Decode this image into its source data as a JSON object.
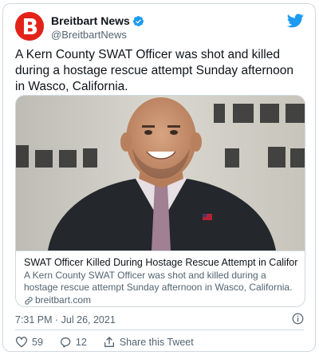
{
  "account": {
    "display_name": "Breitbart News",
    "handle": "@BreitbartNews",
    "verified": true,
    "avatar_color": "#e2231a"
  },
  "tweet": {
    "text": "A Kern County SWAT Officer was shot and killed during a hostage rescue attempt Sunday afternoon in Wasco, California.",
    "timestamp": "7:31 PM · Jul 26, 2021"
  },
  "card": {
    "title": "SWAT Officer Killed During Hostage Rescue Attempt in California",
    "description": "A Kern County SWAT Officer was shot and killed during a hostage rescue attempt Sunday afternoon in Wasco, California.",
    "domain": "breitbart.com"
  },
  "actions": {
    "likes": "59",
    "replies": "12",
    "share_label": "Share this Tweet"
  },
  "icons": {
    "brand": "twitter-bird-icon",
    "verified": "verified-badge-icon",
    "info": "info-icon",
    "link": "link-icon",
    "like": "heart-icon",
    "reply": "reply-icon",
    "share": "share-icon"
  },
  "colors": {
    "twitter_blue": "#1d9bf0",
    "text_secondary": "#536471",
    "border": "#cfd9de"
  }
}
